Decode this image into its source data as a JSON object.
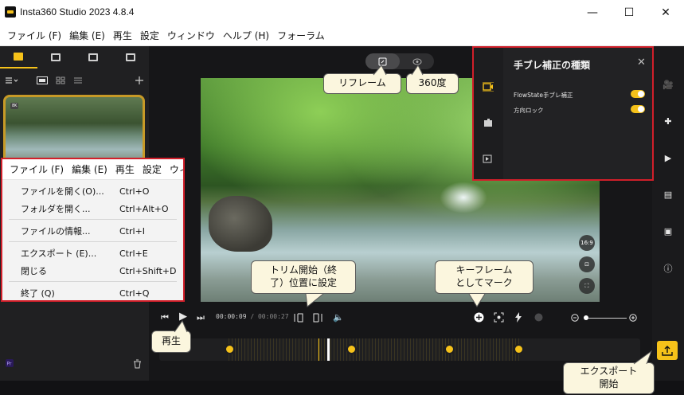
{
  "window": {
    "title": "Insta360 Studio 2023 4.8.4",
    "minimize_glyph": "—",
    "maximize_glyph": "☐",
    "close_glyph": "✕"
  },
  "menubar": {
    "items": [
      "ファイル (F)",
      "編集 (E)",
      "再生",
      "設定",
      "ウィンドウ",
      "ヘルプ (H)",
      "フォーラム"
    ]
  },
  "left_panel": {
    "tabs": [
      "media-library-icon",
      "folder-icon",
      "import-icon",
      "edit-list-icon"
    ],
    "active_tab": 0,
    "thumbnail_badge": "8K",
    "icons": [
      "sort-icon",
      "grid-view-icon",
      "thumbnail-view-icon",
      "list-view-icon",
      "add-icon",
      "premiere-icon",
      "trash-icon"
    ]
  },
  "mode_toggle": {
    "reframe_icon": "reframe-icon",
    "view360_icon": "eye-icon",
    "active": "reframe"
  },
  "video": {
    "aspect_label": "16:9"
  },
  "transport": {
    "time_current": "00:00:09",
    "time_total": "/ 00:00:27"
  },
  "stabilization_panel": {
    "title": "手ブレ補正の種類",
    "rows": [
      {
        "label": "FlowState手ブレ補正",
        "enabled": true
      },
      {
        "label": "方向ロック",
        "enabled": true
      }
    ]
  },
  "file_menu": {
    "menubar_items": [
      "ファイル (F)",
      "編集 (E)",
      "再生",
      "設定",
      "ウィン"
    ],
    "entries": [
      {
        "label": "ファイルを開く(O)...",
        "shortcut": "Ctrl+O"
      },
      {
        "label": "フォルダを開く...",
        "shortcut": "Ctrl+Alt+O"
      },
      {
        "label": "ファイルの情報...",
        "shortcut": "Ctrl+I"
      },
      {
        "label": "エクスポート (E)...",
        "shortcut": "Ctrl+E"
      },
      {
        "label": "閉じる",
        "shortcut": "Ctrl+Shift+D"
      },
      {
        "label": "終了 (Q)",
        "shortcut": "Ctrl+Q"
      }
    ]
  },
  "callouts": {
    "reframe": "リフレーム",
    "view360": "360度",
    "trim": [
      "トリム開始（終",
      "了）位置に設定"
    ],
    "keyframe": [
      "キーフレーム",
      "としてマーク"
    ],
    "play": "再生",
    "export": [
      "エクスポート",
      "開始"
    ]
  },
  "colors": {
    "accent": "#f6c21a",
    "highlight_border": "#d11f2a",
    "callout_bg": "#fbf6de"
  }
}
